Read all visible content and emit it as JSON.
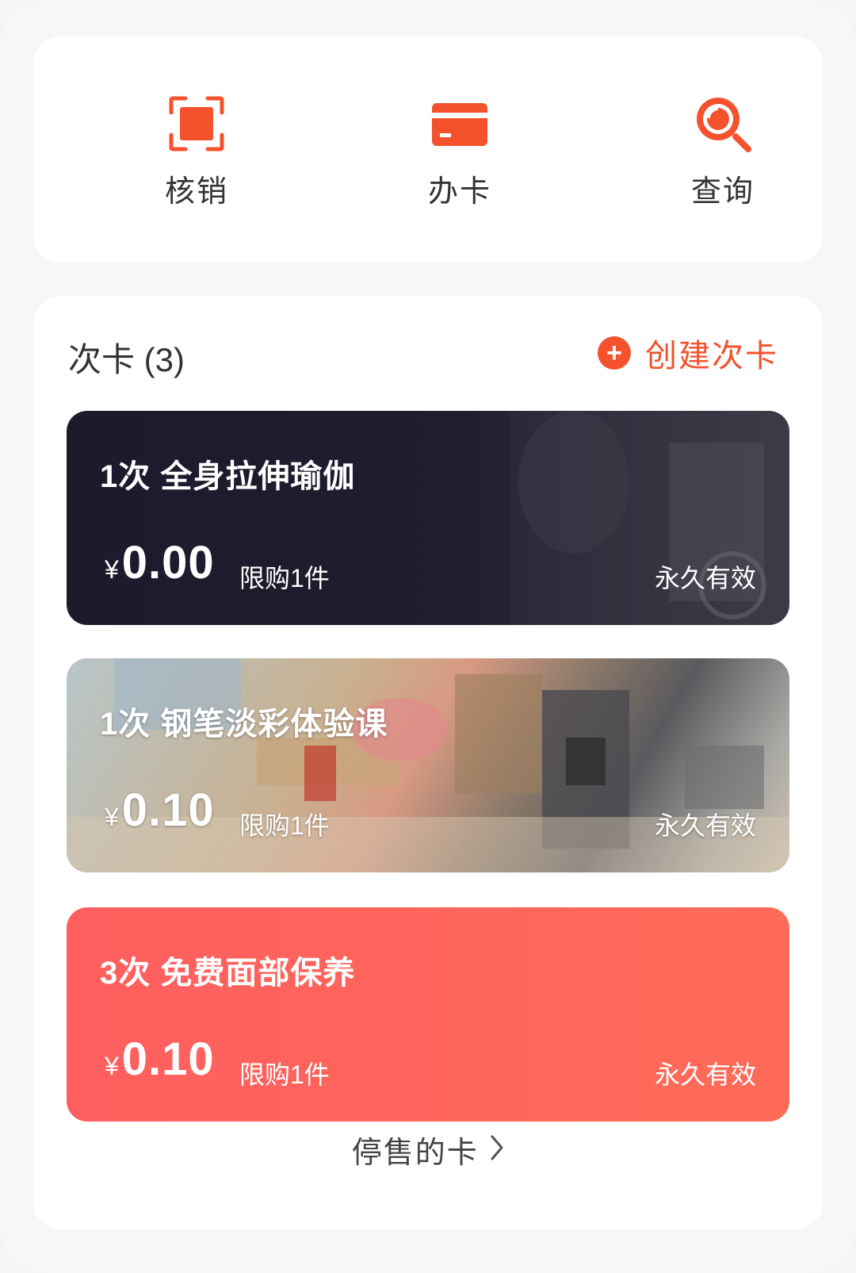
{
  "actions": [
    {
      "label": "核销",
      "icon": "scan-icon"
    },
    {
      "label": "办卡",
      "icon": "card-icon"
    },
    {
      "label": "查询",
      "icon": "search-icon"
    }
  ],
  "section": {
    "title": "次卡 (3)",
    "create_label": "创建次卡",
    "create_icon": "plus-circle-icon"
  },
  "cards": [
    {
      "title": "1次 全身拉伸瑜伽",
      "currency": "¥",
      "price": "0.00",
      "limit": "限购1件",
      "validity": "永久有效"
    },
    {
      "title": "1次 钢笔淡彩体验课",
      "currency": "¥",
      "price": "0.10",
      "limit": "限购1件",
      "validity": "永久有效"
    },
    {
      "title": "3次 免费面部保养",
      "currency": "¥",
      "price": "0.10",
      "limit": "限购1件",
      "validity": "永久有效"
    }
  ],
  "footer": {
    "stopped_label": "停售的卡"
  },
  "colors": {
    "accent": "#f4522d",
    "card_dark": "#1c1a2b",
    "card_coral": "#ff5f5f"
  }
}
